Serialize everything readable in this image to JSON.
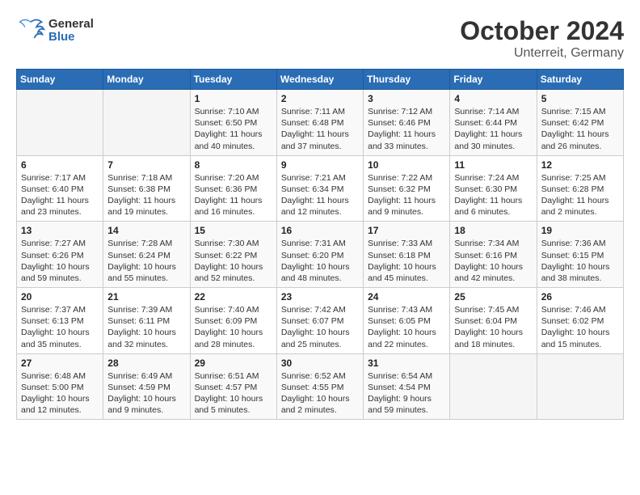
{
  "header": {
    "logo_general": "General",
    "logo_blue": "Blue",
    "month_title": "October 2024",
    "location": "Unterreit, Germany"
  },
  "days_of_week": [
    "Sunday",
    "Monday",
    "Tuesday",
    "Wednesday",
    "Thursday",
    "Friday",
    "Saturday"
  ],
  "weeks": [
    [
      {
        "day": "",
        "info": ""
      },
      {
        "day": "",
        "info": ""
      },
      {
        "day": "1",
        "info": "Sunrise: 7:10 AM\nSunset: 6:50 PM\nDaylight: 11 hours and 40 minutes."
      },
      {
        "day": "2",
        "info": "Sunrise: 7:11 AM\nSunset: 6:48 PM\nDaylight: 11 hours and 37 minutes."
      },
      {
        "day": "3",
        "info": "Sunrise: 7:12 AM\nSunset: 6:46 PM\nDaylight: 11 hours and 33 minutes."
      },
      {
        "day": "4",
        "info": "Sunrise: 7:14 AM\nSunset: 6:44 PM\nDaylight: 11 hours and 30 minutes."
      },
      {
        "day": "5",
        "info": "Sunrise: 7:15 AM\nSunset: 6:42 PM\nDaylight: 11 hours and 26 minutes."
      }
    ],
    [
      {
        "day": "6",
        "info": "Sunrise: 7:17 AM\nSunset: 6:40 PM\nDaylight: 11 hours and 23 minutes."
      },
      {
        "day": "7",
        "info": "Sunrise: 7:18 AM\nSunset: 6:38 PM\nDaylight: 11 hours and 19 minutes."
      },
      {
        "day": "8",
        "info": "Sunrise: 7:20 AM\nSunset: 6:36 PM\nDaylight: 11 hours and 16 minutes."
      },
      {
        "day": "9",
        "info": "Sunrise: 7:21 AM\nSunset: 6:34 PM\nDaylight: 11 hours and 12 minutes."
      },
      {
        "day": "10",
        "info": "Sunrise: 7:22 AM\nSunset: 6:32 PM\nDaylight: 11 hours and 9 minutes."
      },
      {
        "day": "11",
        "info": "Sunrise: 7:24 AM\nSunset: 6:30 PM\nDaylight: 11 hours and 6 minutes."
      },
      {
        "day": "12",
        "info": "Sunrise: 7:25 AM\nSunset: 6:28 PM\nDaylight: 11 hours and 2 minutes."
      }
    ],
    [
      {
        "day": "13",
        "info": "Sunrise: 7:27 AM\nSunset: 6:26 PM\nDaylight: 10 hours and 59 minutes."
      },
      {
        "day": "14",
        "info": "Sunrise: 7:28 AM\nSunset: 6:24 PM\nDaylight: 10 hours and 55 minutes."
      },
      {
        "day": "15",
        "info": "Sunrise: 7:30 AM\nSunset: 6:22 PM\nDaylight: 10 hours and 52 minutes."
      },
      {
        "day": "16",
        "info": "Sunrise: 7:31 AM\nSunset: 6:20 PM\nDaylight: 10 hours and 48 minutes."
      },
      {
        "day": "17",
        "info": "Sunrise: 7:33 AM\nSunset: 6:18 PM\nDaylight: 10 hours and 45 minutes."
      },
      {
        "day": "18",
        "info": "Sunrise: 7:34 AM\nSunset: 6:16 PM\nDaylight: 10 hours and 42 minutes."
      },
      {
        "day": "19",
        "info": "Sunrise: 7:36 AM\nSunset: 6:15 PM\nDaylight: 10 hours and 38 minutes."
      }
    ],
    [
      {
        "day": "20",
        "info": "Sunrise: 7:37 AM\nSunset: 6:13 PM\nDaylight: 10 hours and 35 minutes."
      },
      {
        "day": "21",
        "info": "Sunrise: 7:39 AM\nSunset: 6:11 PM\nDaylight: 10 hours and 32 minutes."
      },
      {
        "day": "22",
        "info": "Sunrise: 7:40 AM\nSunset: 6:09 PM\nDaylight: 10 hours and 28 minutes."
      },
      {
        "day": "23",
        "info": "Sunrise: 7:42 AM\nSunset: 6:07 PM\nDaylight: 10 hours and 25 minutes."
      },
      {
        "day": "24",
        "info": "Sunrise: 7:43 AM\nSunset: 6:05 PM\nDaylight: 10 hours and 22 minutes."
      },
      {
        "day": "25",
        "info": "Sunrise: 7:45 AM\nSunset: 6:04 PM\nDaylight: 10 hours and 18 minutes."
      },
      {
        "day": "26",
        "info": "Sunrise: 7:46 AM\nSunset: 6:02 PM\nDaylight: 10 hours and 15 minutes."
      }
    ],
    [
      {
        "day": "27",
        "info": "Sunrise: 6:48 AM\nSunset: 5:00 PM\nDaylight: 10 hours and 12 minutes."
      },
      {
        "day": "28",
        "info": "Sunrise: 6:49 AM\nSunset: 4:59 PM\nDaylight: 10 hours and 9 minutes."
      },
      {
        "day": "29",
        "info": "Sunrise: 6:51 AM\nSunset: 4:57 PM\nDaylight: 10 hours and 5 minutes."
      },
      {
        "day": "30",
        "info": "Sunrise: 6:52 AM\nSunset: 4:55 PM\nDaylight: 10 hours and 2 minutes."
      },
      {
        "day": "31",
        "info": "Sunrise: 6:54 AM\nSunset: 4:54 PM\nDaylight: 9 hours and 59 minutes."
      },
      {
        "day": "",
        "info": ""
      },
      {
        "day": "",
        "info": ""
      }
    ]
  ]
}
